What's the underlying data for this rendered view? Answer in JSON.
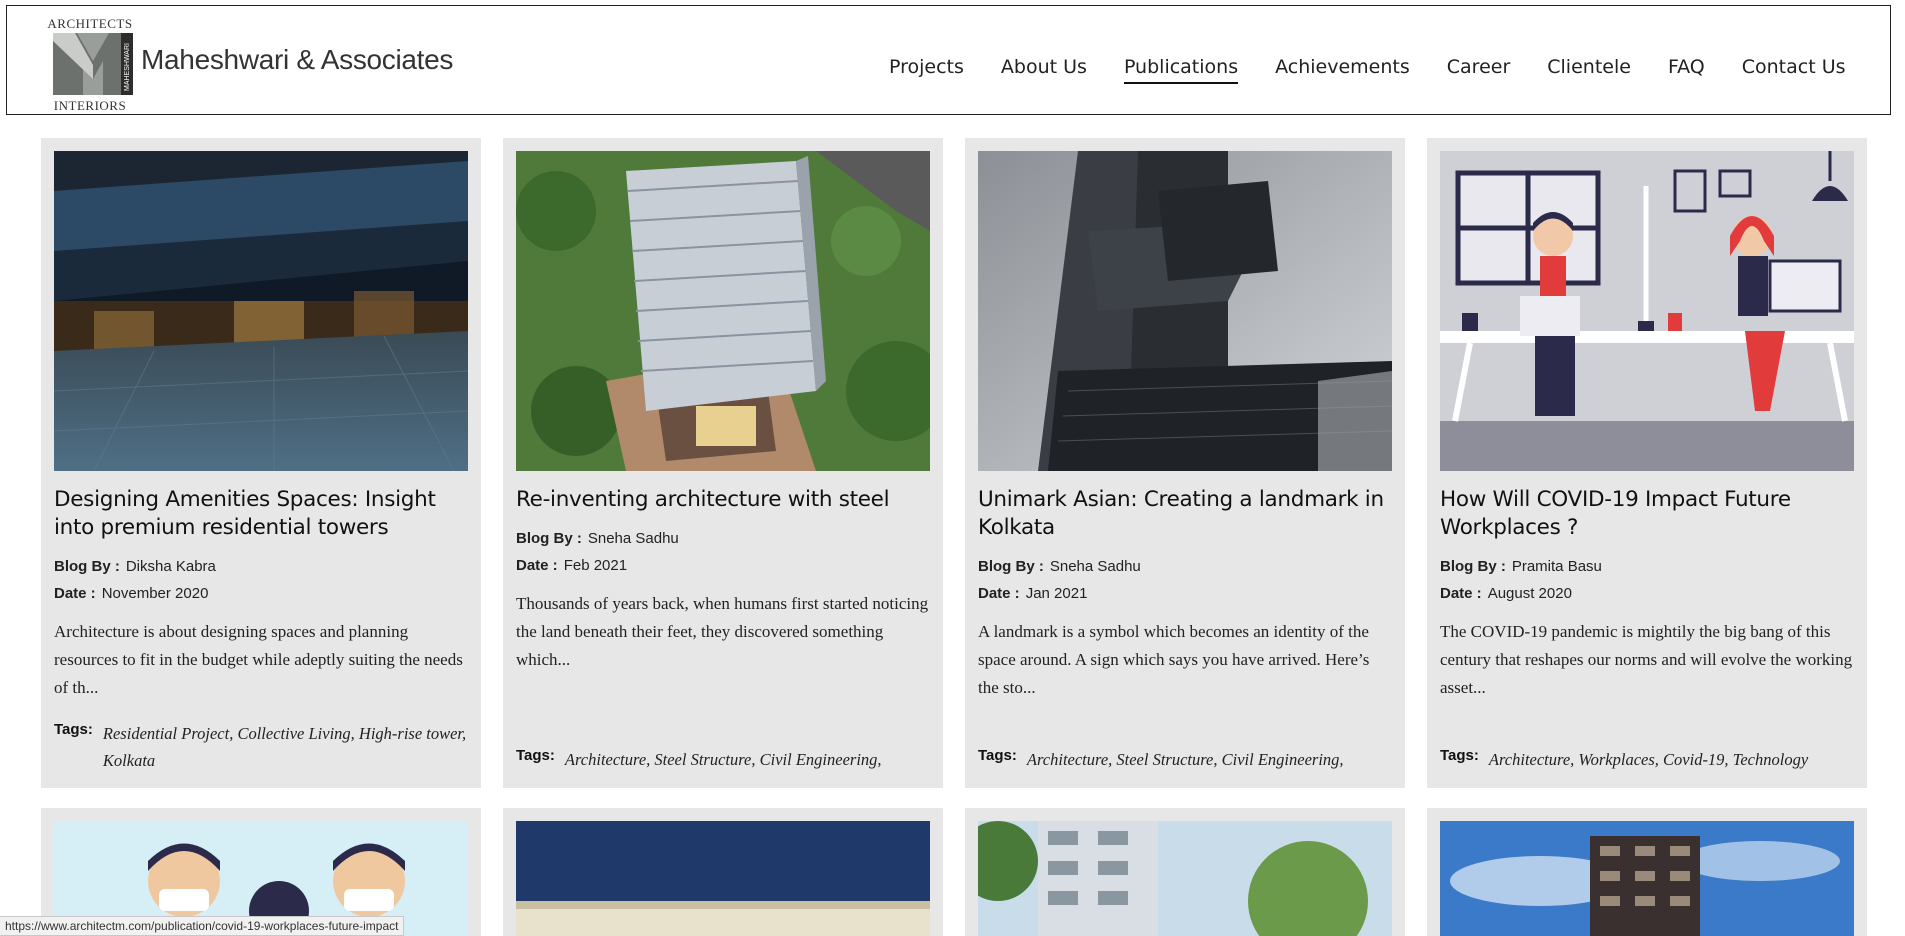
{
  "logo": {
    "top_text": "ARCHITECTS",
    "bottom_text": "INTERIORS",
    "vertical_text": "MAHESHWARI"
  },
  "brand": "Maheshwari & Associates",
  "nav": {
    "items": [
      {
        "label": "Projects"
      },
      {
        "label": "About Us"
      },
      {
        "label": "Publications",
        "active": true
      },
      {
        "label": "Achievements"
      },
      {
        "label": "Career"
      },
      {
        "label": "Clientele"
      },
      {
        "label": "FAQ"
      },
      {
        "label": "Contact Us"
      }
    ]
  },
  "labels": {
    "blog_by": "Blog By :",
    "date": "Date :",
    "tags": "Tags:"
  },
  "cards": [
    {
      "title": "Designing Amenities Spaces: Insight into premium residential towers",
      "author": "Diksha Kabra",
      "date": "November 2020",
      "excerpt": "Architecture is about designing spaces and planning resources to fit in the budget while adeptly suiting the needs of th...",
      "tags": "Residential Project, Collective Living, High-rise tower, Kolkata"
    },
    {
      "title": "Re-inventing architecture with steel",
      "author": "Sneha Sadhu",
      "date": "Feb 2021",
      "excerpt": "Thousands of years back, when humans first started noticing the land beneath their feet, they discovered something which...",
      "tags": "Architecture, Steel Structure, Civil Engineering,"
    },
    {
      "title": "Unimark Asian: Creating a landmark in Kolkata",
      "author": "Sneha Sadhu",
      "date": "Jan 2021",
      "excerpt": "A landmark is a symbol which becomes an identity of the space around. A sign which says you have arrived. Here’s the sto...",
      "tags": "Architecture, Steel Structure, Civil Engineering,"
    },
    {
      "title": "How Will COVID-19 Impact Future Workplaces ?",
      "author": "Pramita Basu",
      "date": "August 2020",
      "excerpt": "The COVID-19 pandemic is mightily the big bang of this century that reshapes our norms and will evolve the working asset...",
      "tags": "Architecture, Workplaces, Covid-19, Technology"
    }
  ],
  "status_url": "https://www.architectm.com/publication/covid-19-workplaces-future-impact"
}
